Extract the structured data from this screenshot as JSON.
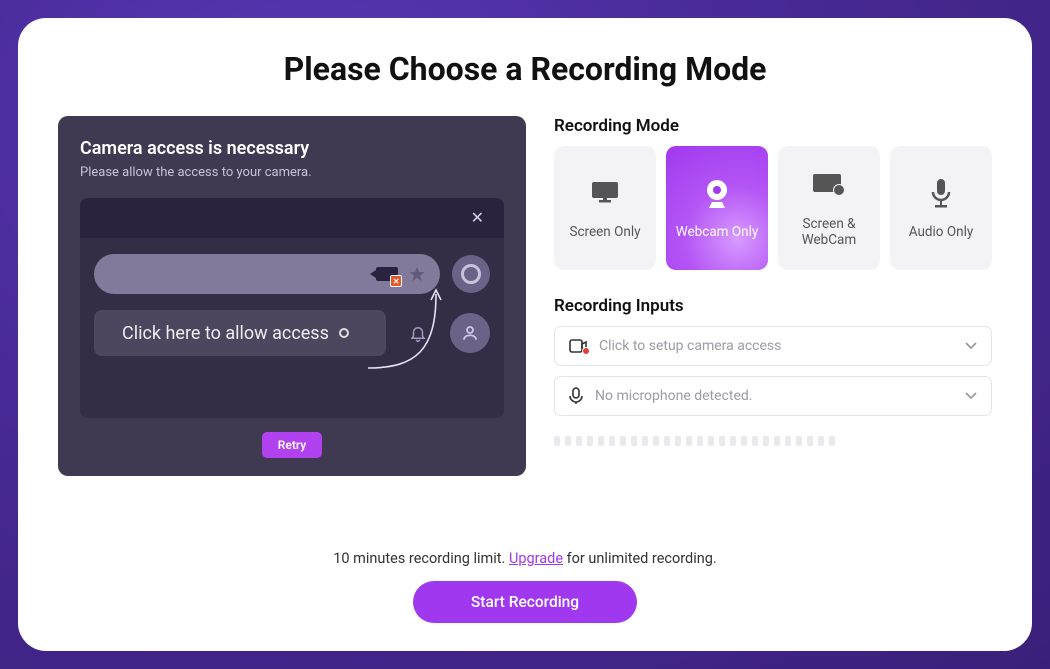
{
  "title": "Please Choose a Recording Mode",
  "preview": {
    "heading": "Camera access is necessary",
    "sub": "Please allow the access to your camera.",
    "instruction": "Click here to allow access",
    "retry": "Retry"
  },
  "modes_label": "Recording Mode",
  "modes": [
    {
      "key": "screen",
      "label": "Screen Only"
    },
    {
      "key": "webcam",
      "label": "Webcam Only"
    },
    {
      "key": "both",
      "label": "Screen & WebCam"
    },
    {
      "key": "audio",
      "label": "Audio Only"
    }
  ],
  "selected_mode": "webcam",
  "inputs_label": "Recording Inputs",
  "inputs": {
    "camera": "Click to setup camera access",
    "mic": "No microphone detected."
  },
  "footer": {
    "prefix": "10 minutes recording limit. ",
    "upgrade": "Upgrade",
    "suffix": " for unlimited recording.",
    "start": "Start Recording"
  }
}
